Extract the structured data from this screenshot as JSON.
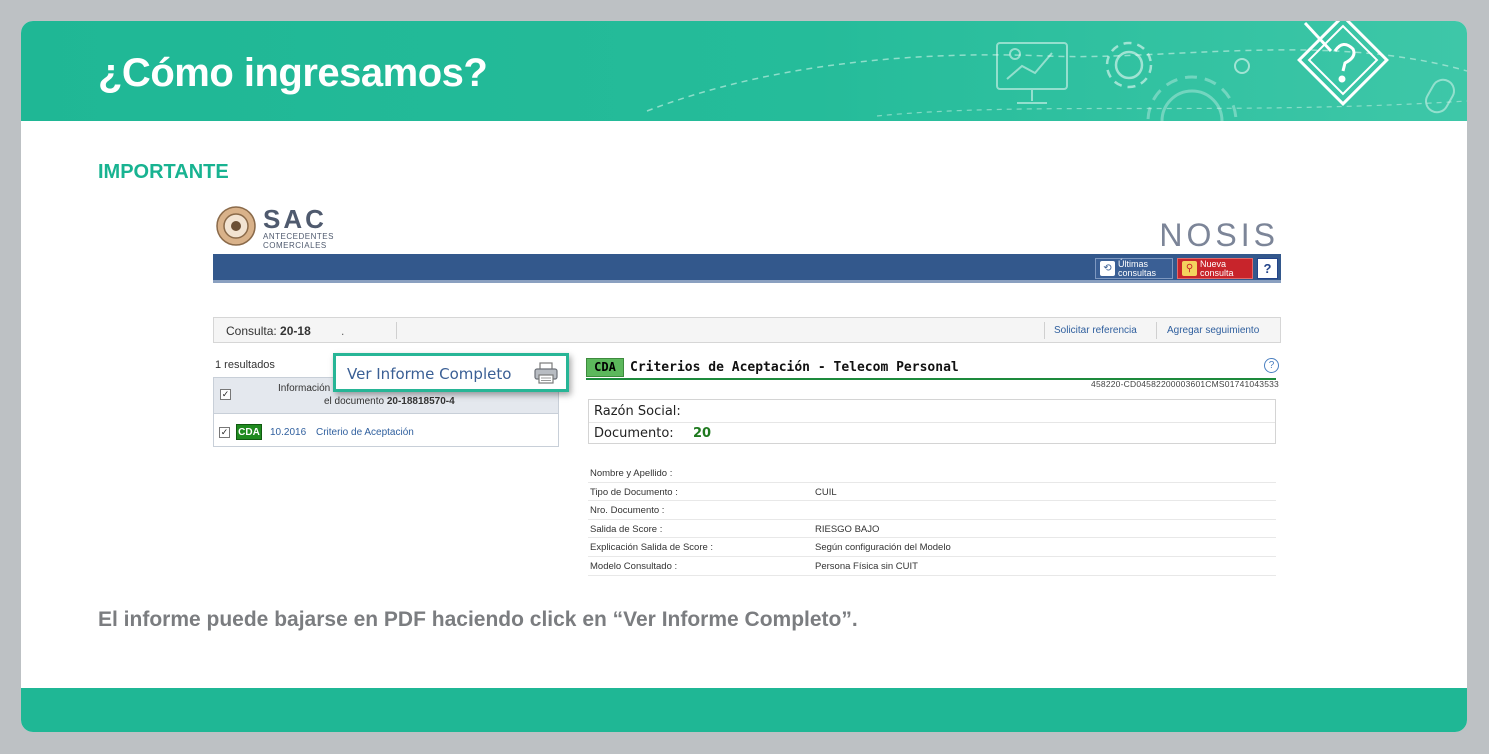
{
  "slide": {
    "title": "¿Cómo ingresamos?",
    "section_label": "IMPORTANTE",
    "caption": "El informe puede bajarse en PDF haciendo click en “Ver Informe Completo”."
  },
  "app": {
    "logo_name": "SAC",
    "logo_sub_line1": "ANTECEDENTES",
    "logo_sub_line2": "COMERCIALES",
    "brand": "NOSIS",
    "toolbar": {
      "ultimas_line1": "Últimas",
      "ultimas_line2": "consultas",
      "nueva_line1": "Nueva",
      "nueva_line2": "consulta",
      "help": "?"
    },
    "query": {
      "label": "Consulta:",
      "value": "20-18",
      "dot": ".",
      "link_referencia": "Solicitar referencia",
      "link_seguimiento": "Agregar seguimiento"
    },
    "results_count": "1 resultados",
    "results_header_line1": "Información",
    "results_header_line2_prefix": "el documento",
    "results_header_doc": "20-18818570-4",
    "result_row": {
      "badge": "CDA",
      "date": "10.2016",
      "link": "Criterio de Aceptación"
    },
    "popup_label": "Ver Informe Completo",
    "report": {
      "badge": "CDA",
      "title": "Criterios de Aceptación - Telecom Personal",
      "help": "?",
      "ref_code": "458220-CD04582200003601CMS01741043533",
      "razon_label": "Razón Social:",
      "documento_label": "Documento:",
      "documento_value": "20"
    },
    "details": [
      {
        "label": "Nombre y Apellido :",
        "value": ""
      },
      {
        "label": "Tipo de Documento :",
        "value": "CUIL"
      },
      {
        "label": "Nro. Documento :",
        "value": ""
      },
      {
        "label": "Salida de Score :",
        "value": "RIESGO BAJO"
      },
      {
        "label": "Explicación Salida de Score :",
        "value": "Según configuración del Modelo"
      },
      {
        "label": "Modelo Consultado :",
        "value": "Persona Física sin CUIT"
      }
    ]
  },
  "colors": {
    "header_green": "#1fb795",
    "section_green": "#18b391",
    "caption_gray": "#7b7d80",
    "nav_blue": "#33588c"
  },
  "icons": [
    "presentation-board-icon",
    "gear-icon",
    "help-diamond-icon",
    "mouse-icon",
    "printer-icon",
    "history-icon",
    "search-icon"
  ]
}
